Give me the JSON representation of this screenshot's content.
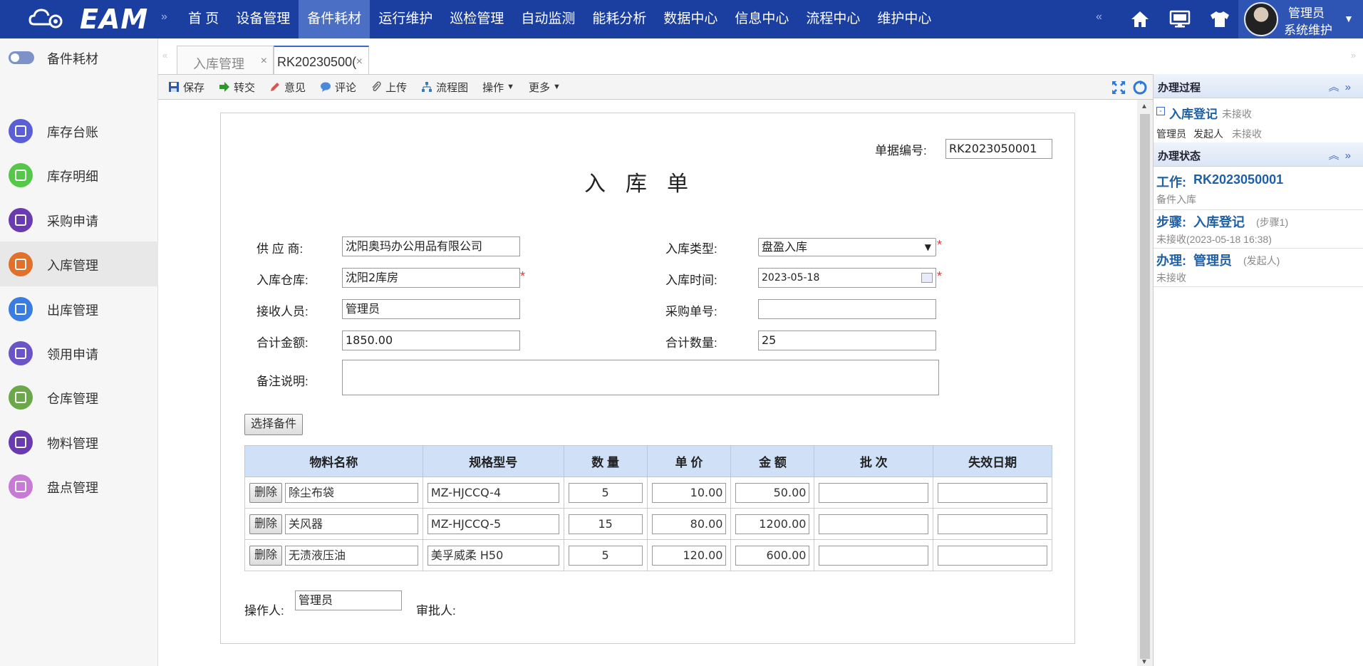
{
  "app": {
    "logo_text": "EAM"
  },
  "nav": {
    "items": [
      "首 页",
      "设备管理",
      "备件耗材",
      "运行维护",
      "巡检管理",
      "自动监测",
      "能耗分析",
      "数据中心",
      "信息中心",
      "流程中心",
      "维护中心"
    ],
    "active_index": 2,
    "left_arrow": "»",
    "right_arrow": "«"
  },
  "user": {
    "name": "管理员",
    "role": "系统维护"
  },
  "sidebar": {
    "title": "备件耗材",
    "items": [
      {
        "label": "库存台账",
        "icon": "ledger-icon",
        "color": "#5a5fd6"
      },
      {
        "label": "库存明细",
        "icon": "inventory-detail-icon",
        "color": "#55c84a"
      },
      {
        "label": "采购申请",
        "icon": "cart-icon",
        "color": "#6a3bb0"
      },
      {
        "label": "入库管理",
        "icon": "stock-in-icon",
        "color": "#e0702a"
      },
      {
        "label": "出库管理",
        "icon": "truck-icon",
        "color": "#3a7de0"
      },
      {
        "label": "领用申请",
        "icon": "inbox-icon",
        "color": "#6a55c8"
      },
      {
        "label": "仓库管理",
        "icon": "warehouse-icon",
        "color": "#6aa84a"
      },
      {
        "label": "物料管理",
        "icon": "materials-icon",
        "color": "#6a3bb0"
      },
      {
        "label": "盘点管理",
        "icon": "stocktake-icon",
        "color": "#c77ad6"
      }
    ],
    "active_index": 3
  },
  "tabs": [
    {
      "label": "入库管理",
      "close": "×"
    },
    {
      "label": "RK20230500(",
      "close": "×"
    }
  ],
  "toolbar": {
    "save": "保存",
    "forward": "转交",
    "opinion": "意见",
    "comment": "评论",
    "upload": "上传",
    "flowchart": "流程图",
    "operation": "操作",
    "more": "更多"
  },
  "form": {
    "doc_no_label": "单据编号:",
    "doc_no": "RK2023050001",
    "title": "入库单",
    "supplier_label": "供 应 商:",
    "supplier": "沈阳奥玛办公用品有限公司",
    "type_label": "入库类型:",
    "type": "盘盈入库",
    "warehouse_label": "入库仓库:",
    "warehouse": "沈阳2库房",
    "time_label": "入库时间:",
    "time": "2023-05-18",
    "receiver_label": "接收人员:",
    "receiver": "管理员",
    "po_label": "采购单号:",
    "po": "",
    "amount_label": "合计金额:",
    "amount": "1850.00",
    "qty_label": "合计数量:",
    "qty": "25",
    "remark_label": "备注说明:",
    "remark": "",
    "select_btn": "选择备件",
    "operator_label": "操作人:",
    "operator": "管理员",
    "approver_label": "审批人:"
  },
  "grid": {
    "columns": [
      "物料名称",
      "规格型号",
      "数 量",
      "单 价",
      "金 额",
      "批 次",
      "失效日期"
    ],
    "delete_label": "删除",
    "rows": [
      {
        "name": "除尘布袋",
        "spec": "MZ-HJCCQ-4",
        "qty": "5",
        "price": "10.00",
        "amount": "50.00",
        "batch": "",
        "expiry": ""
      },
      {
        "name": "关风器",
        "spec": "MZ-HJCCQ-5",
        "qty": "15",
        "price": "80.00",
        "amount": "1200.00",
        "batch": "",
        "expiry": ""
      },
      {
        "name": "无渍液压油",
        "spec": "美孚威柔 H50",
        "qty": "5",
        "price": "120.00",
        "amount": "600.00",
        "batch": "",
        "expiry": ""
      }
    ]
  },
  "right_panel": {
    "process_title": "办理过程",
    "process_step": "入库登记",
    "process_step_status": "未接收",
    "process_user": "管理员",
    "process_user_role": "发起人",
    "process_user_status": "未接收",
    "status_title": "办理状态",
    "work_label": "工作:",
    "work_no": "RK2023050001",
    "work_sub": "备件入库",
    "step_label": "步骤:",
    "step_name": "入库登记",
    "step_no": "(步骤1)",
    "step_status": "未接收(2023-05-18 16:38)",
    "handle_label": "办理:",
    "handle_user": "管理员",
    "handle_role": "(发起人)",
    "handle_status": "未接收"
  }
}
